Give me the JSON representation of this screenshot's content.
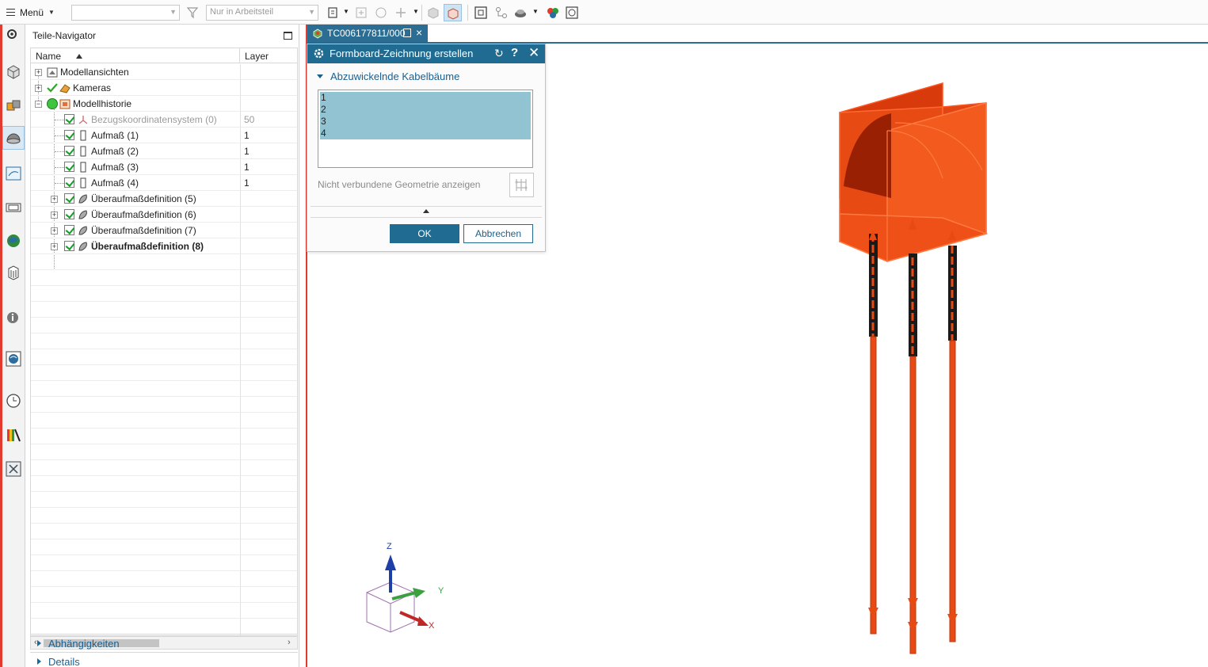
{
  "toolbar": {
    "menu_label": "Menü",
    "selection_filter": "",
    "scope_placeholder": "Nur in Arbeitsteil"
  },
  "resource_bar": {
    "icons": [
      "settings-icon",
      "assembly-navigator-icon",
      "constraint-navigator-icon",
      "part-navigator-icon",
      "formboard-icon",
      "reuse-library-icon",
      "web-browser-icon",
      "teamcenter-icon",
      "info-icon",
      "roles-icon",
      "history-icon",
      "palette-icon",
      "tools-icon"
    ]
  },
  "navigator": {
    "title": "Teile-Navigator",
    "columns": {
      "name": "Name",
      "layer": "Layer"
    },
    "rows": [
      {
        "label": "Modellansichten",
        "layer": "",
        "level": 0,
        "expander": "+",
        "icon": "model-views-icon",
        "check": false
      },
      {
        "label": "Kameras",
        "layer": "",
        "level": 0,
        "expander": "+",
        "icon": "camera-icon",
        "check": true
      },
      {
        "label": "Modellhistorie",
        "layer": "",
        "level": 0,
        "expander": "−",
        "icon": "history-icon",
        "check": false
      },
      {
        "label": "Bezugskoordinatensystem (0)",
        "layer": "50",
        "level": 1,
        "expander": "",
        "icon": "datum-csys-icon",
        "check": true,
        "dim": true
      },
      {
        "label": "Aufmaß (1)",
        "layer": "1",
        "level": 1,
        "expander": "",
        "icon": "allowance-icon",
        "check": true
      },
      {
        "label": "Aufmaß (2)",
        "layer": "1",
        "level": 1,
        "expander": "",
        "icon": "allowance-icon",
        "check": true
      },
      {
        "label": "Aufmaß (3)",
        "layer": "1",
        "level": 1,
        "expander": "",
        "icon": "allowance-icon",
        "check": true
      },
      {
        "label": "Aufmaß (4)",
        "layer": "1",
        "level": 1,
        "expander": "",
        "icon": "allowance-icon",
        "check": true
      },
      {
        "label": "Überaufmaßdefinition (5)",
        "layer": "",
        "level": 1,
        "expander": "+",
        "icon": "overstock-icon",
        "check": true
      },
      {
        "label": "Überaufmaßdefinition (6)",
        "layer": "",
        "level": 1,
        "expander": "+",
        "icon": "overstock-icon",
        "check": true
      },
      {
        "label": "Überaufmaßdefinition (7)",
        "layer": "",
        "level": 1,
        "expander": "+",
        "icon": "overstock-icon",
        "check": true
      },
      {
        "label": "Überaufmaßdefinition (8)",
        "layer": "",
        "level": 1,
        "expander": "+",
        "icon": "overstock-icon",
        "check": true,
        "bold": true
      }
    ],
    "sections": {
      "dependencies": "Abhängigkeiten",
      "details": "Details"
    }
  },
  "graphics": {
    "tab_title": "TC006177811/000"
  },
  "dialog": {
    "title": "Formboard-Zeichnung erstellen",
    "group_title": "Abzuwickelnde Kabelbäume",
    "harness_items": [
      "1",
      "2",
      "3",
      "4"
    ],
    "show_unconnected_label": "Nicht verbundene Geometrie anzeigen",
    "ok_label": "OK",
    "cancel_label": "Abbrechen"
  },
  "triad": {
    "x": "X",
    "y": "Y",
    "z": "Z"
  },
  "colors": {
    "accent": "#1f6b91",
    "model_red": "#f04010",
    "selection": "#91c3d2",
    "red_border": "#e23a2f"
  }
}
